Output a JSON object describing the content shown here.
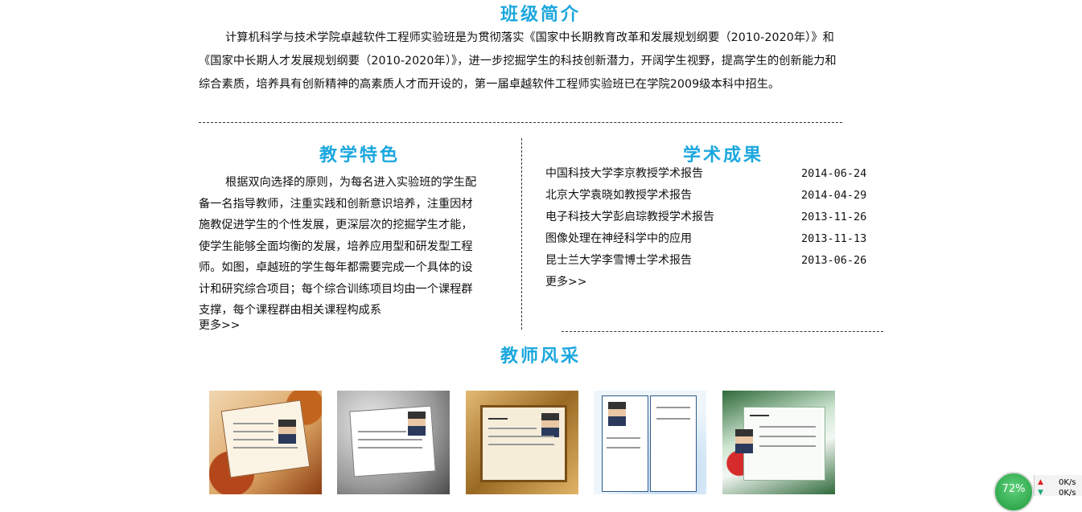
{
  "intro": {
    "title": "班级简介",
    "text": "计算机科学与技术学院卓越软件工程师实验班是为贯彻落实《国家中长期教育改革和发展规划纲要（2010-2020年）》和《国家中长期人才发展规划纲要（2010-2020年）》，进一步挖掘学生的科技创新潜力，开阔学生视野，提高学生的创新能力和综合素质，培养具有创新精神的高素质人才而开设的，第一届卓越软件工程师实验班已在学院2009级本科中招生。"
  },
  "features": {
    "title": "教学特色",
    "text": "根据双向选择的原则，为每名进入实验班的学生配备一名指导教师，注重实践和创新意识培养，注重因材施教促进学生的个性发展，更深层次的挖掘学生才能，使学生能够全面均衡的发展，培养应用型和研发型工程师。如图，卓越班的学生每年都需要完成一个具体的设计和研究综合项目；每个综合训练项目均由一个课程群支撑，每个课程群由相关课程构成系",
    "more": "更多>>"
  },
  "achievements": {
    "title": "学术成果",
    "items": [
      {
        "title": "中国科技大学李京教授学术报告",
        "date": "2014-06-24"
      },
      {
        "title": "北京大学袁晓如教授学术报告",
        "date": "2014-04-29"
      },
      {
        "title": "电子科技大学彭启琮教授学术报告",
        "date": "2013-11-26"
      },
      {
        "title": "图像处理在神经科学中的应用",
        "date": "2013-11-13"
      },
      {
        "title": "昆士兰大学李雪博士学术报告",
        "date": "2013-06-26"
      }
    ],
    "more": "更多>>"
  },
  "teachers": {
    "title": "教师风采"
  },
  "speed_widget": {
    "percent": "72%",
    "up": "0K/s",
    "down": "0K/s",
    "up_icon": "arrow-up-icon",
    "down_icon": "arrow-down-icon"
  },
  "colors": {
    "title": "#1ba7de",
    "gauge": "#2fb34f"
  }
}
